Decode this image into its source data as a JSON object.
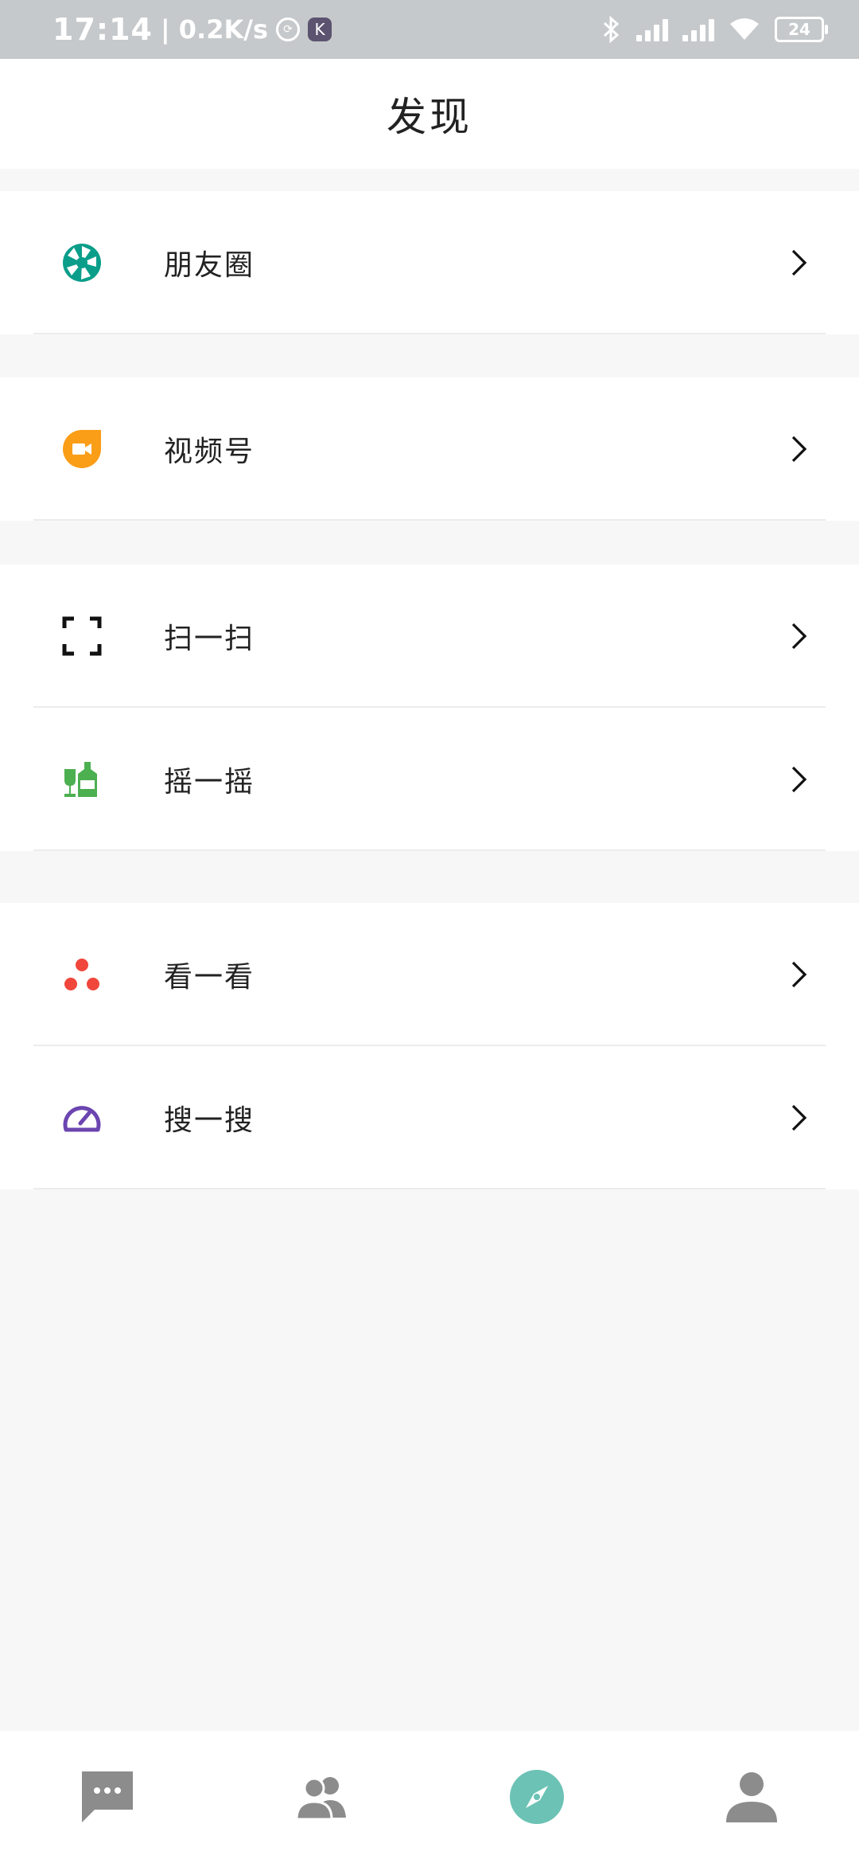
{
  "status_bar": {
    "time": "17:14",
    "net_speed": "| 0.2K/s",
    "app_badge": "K",
    "battery": "24"
  },
  "header": {
    "title": "发现"
  },
  "groups": [
    {
      "items": [
        {
          "label": "朋友圈",
          "icon": "moments-aperture-icon",
          "color": "#0a9e8a"
        }
      ]
    },
    {
      "items": [
        {
          "label": "视频号",
          "icon": "channels-video-icon",
          "color": "#fa9d17"
        }
      ]
    },
    {
      "items": [
        {
          "label": "扫一扫",
          "icon": "scan-icon",
          "color": "#111111"
        },
        {
          "label": "摇一摇",
          "icon": "shake-bottles-icon",
          "color": "#4caf50"
        }
      ]
    },
    {
      "items": [
        {
          "label": "看一看",
          "icon": "top-stories-dots-icon",
          "color": "#f0463c"
        },
        {
          "label": "搜一搜",
          "icon": "search-gauge-icon",
          "color": "#6b45b0"
        }
      ]
    }
  ],
  "bottom_nav": [
    {
      "name": "chats",
      "icon": "chat-bubble-icon",
      "active": false
    },
    {
      "name": "contacts",
      "icon": "contacts-icon",
      "active": false
    },
    {
      "name": "discover",
      "icon": "compass-icon",
      "active": true
    },
    {
      "name": "me",
      "icon": "person-icon",
      "active": false
    }
  ],
  "colors": {
    "active_tab": "#6cc2b5",
    "inactive_tab": "#8c8c8c",
    "background": "#f7f7f7"
  }
}
